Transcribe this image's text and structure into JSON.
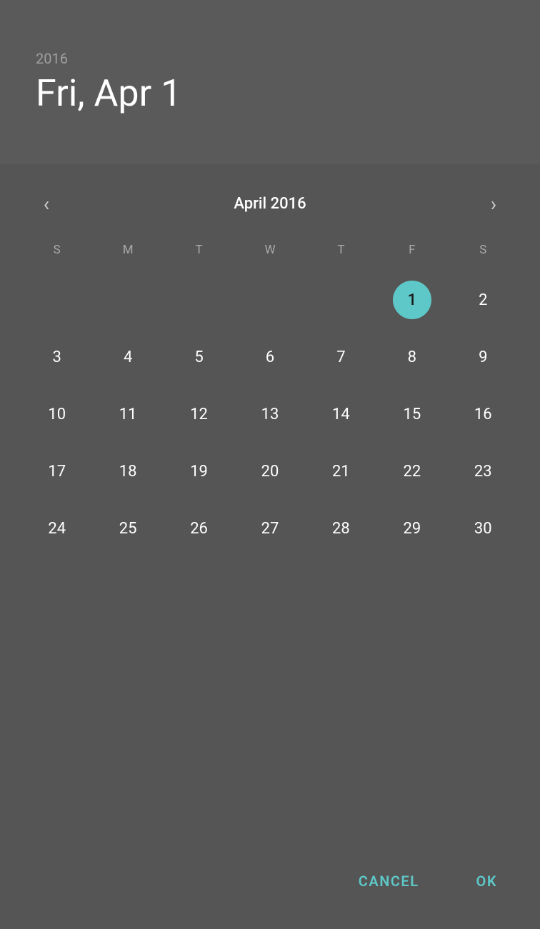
{
  "header": {
    "year": "2016",
    "date": "Fri, Apr 1"
  },
  "calendar": {
    "month_label": "April 2016",
    "day_headers": [
      "S",
      "M",
      "T",
      "W",
      "T",
      "F",
      "S"
    ],
    "selected_day": 1,
    "accent_color": "#5ec8c8",
    "prev_arrow": "‹",
    "next_arrow": "›",
    "weeks": [
      [
        null,
        null,
        null,
        null,
        null,
        1,
        2
      ],
      [
        3,
        4,
        5,
        6,
        7,
        8,
        9
      ],
      [
        10,
        11,
        12,
        13,
        14,
        15,
        16
      ],
      [
        17,
        18,
        19,
        20,
        21,
        22,
        23
      ],
      [
        24,
        25,
        26,
        27,
        28,
        29,
        30
      ]
    ]
  },
  "footer": {
    "cancel_label": "CANCEL",
    "ok_label": "OK"
  }
}
